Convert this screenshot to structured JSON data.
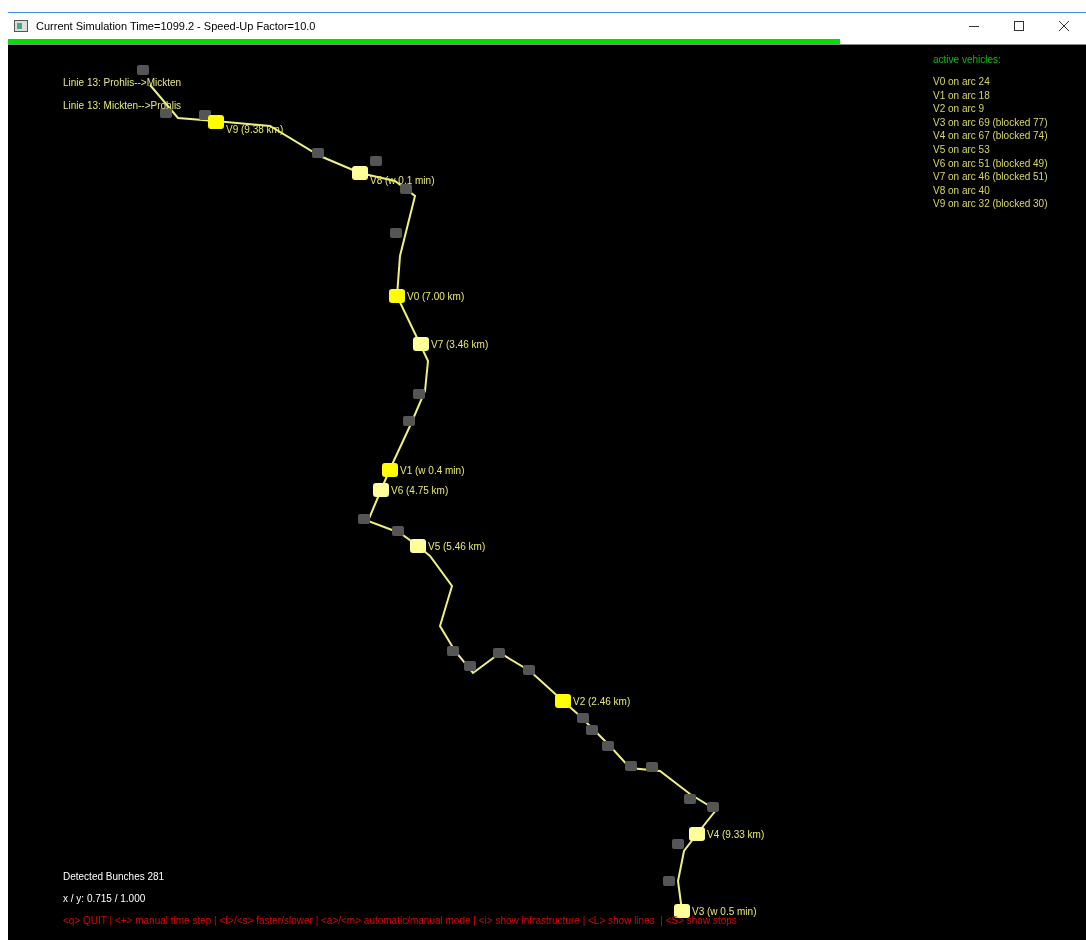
{
  "window": {
    "title": "Current Simulation Time=1099.2 - Speed-Up Factor=10.0"
  },
  "progress": {
    "level": 0.772
  },
  "lines": [
    "Linie 13: Prohlis-->Mickten",
    "Linie 13: Mickten-->Prohlis"
  ],
  "vehicles_on_map": [
    {
      "label": "V9 (9.38 km)",
      "color": "#ffff00"
    },
    {
      "label": "V8 (w 0.1 min)",
      "color": "#ffff99"
    },
    {
      "label": "V0 (7.00 km)",
      "color": "#ffff00"
    },
    {
      "label": "V7 (3.46 km)",
      "color": "#ffff99"
    },
    {
      "label": "V1 (w 0.4 min)",
      "color": "#ffff00"
    },
    {
      "label": "V6 (4.75 km)",
      "color": "#ffff99"
    },
    {
      "label": "V5 (5.46 km)",
      "color": "#ffff99"
    },
    {
      "label": "V2 (2.46 km)",
      "color": "#ffff00"
    },
    {
      "label": "V4 (9.33 km)",
      "color": "#ffff99"
    },
    {
      "label": "V3 (w 0.5 min)",
      "color": "#ffff99"
    }
  ],
  "active_vehicles": {
    "heading": "active vehicles:",
    "items": [
      "V0 on arc 24",
      "V1 on arc 18",
      "V2 on arc 9",
      "V3 on arc 69 (blocked 77)",
      "V4 on arc 67 (blocked 74)",
      "V5 on arc 53",
      "V6 on arc 51 (blocked 49)",
      "V7 on arc 46 (blocked 51)",
      "V8 on arc 40",
      "V9 on arc 32 (blocked 30)"
    ]
  },
  "detected_bunches": "Detected Bunches 281",
  "xy": "x / y: 0.715 / 1.000",
  "help": "<q> QUIT | <+> manual time step | <f>/<s> faster/slower | <a>/<m> automatic/manual mode | <i> show infrastructure | <L> show lines  | <S> show stops"
}
